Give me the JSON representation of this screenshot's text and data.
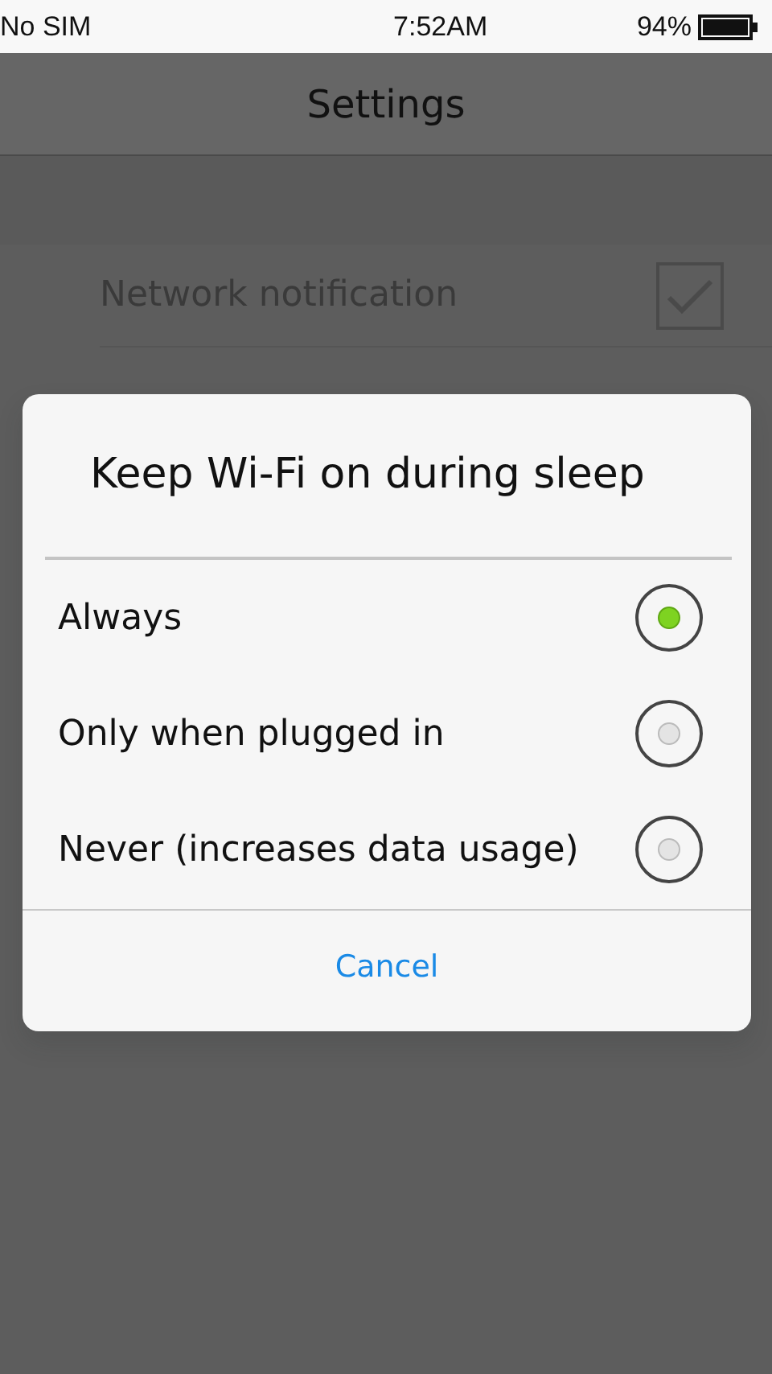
{
  "status_bar": {
    "carrier": "No SIM",
    "time": "7:52AM",
    "battery": "94%"
  },
  "app_bar": {
    "title": "Settings"
  },
  "settings": [
    {
      "kind": "checkbox",
      "label": "Network notification",
      "disabled": true,
      "checked": true
    }
  ],
  "dialog": {
    "title": "Keep Wi-Fi on during sleep",
    "options": [
      {
        "label": "Always",
        "selected": true
      },
      {
        "label": "Only when plugged in",
        "selected": false
      },
      {
        "label": "Never (increases data usage)",
        "selected": false
      }
    ],
    "cancel": "Cancel"
  }
}
